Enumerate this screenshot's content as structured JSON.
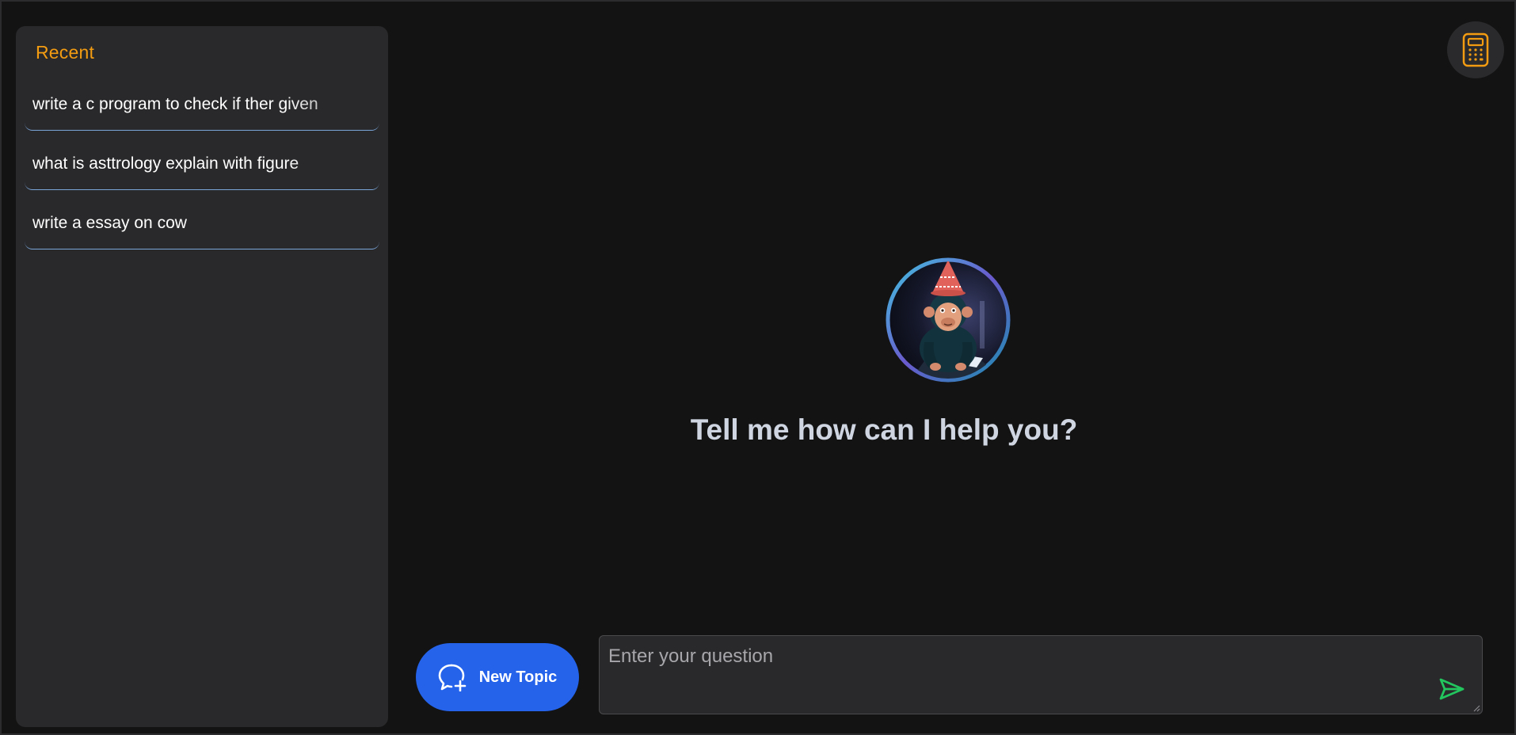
{
  "sidebar": {
    "title": "Recent",
    "items": [
      {
        "label": "write a c program to check if ther given"
      },
      {
        "label": "what is asttrology explain with figure"
      },
      {
        "label": "write a essay on cow"
      }
    ]
  },
  "header": {
    "calculator_icon": "calculator-icon"
  },
  "hero": {
    "avatar_icon": "chimp-mascot-avatar",
    "headline": "Tell me how can I help you?"
  },
  "composer": {
    "new_topic_label": "New Topic",
    "new_topic_icon": "chat-plus-icon",
    "placeholder": "Enter your question",
    "value": "",
    "send_icon": "send-icon"
  },
  "colors": {
    "accent_orange": "#f39c12",
    "primary_blue": "#2563eb",
    "send_green": "#22c55e",
    "divider_blue": "#7aa5d8",
    "background": "#131313",
    "panel": "#29292b"
  }
}
